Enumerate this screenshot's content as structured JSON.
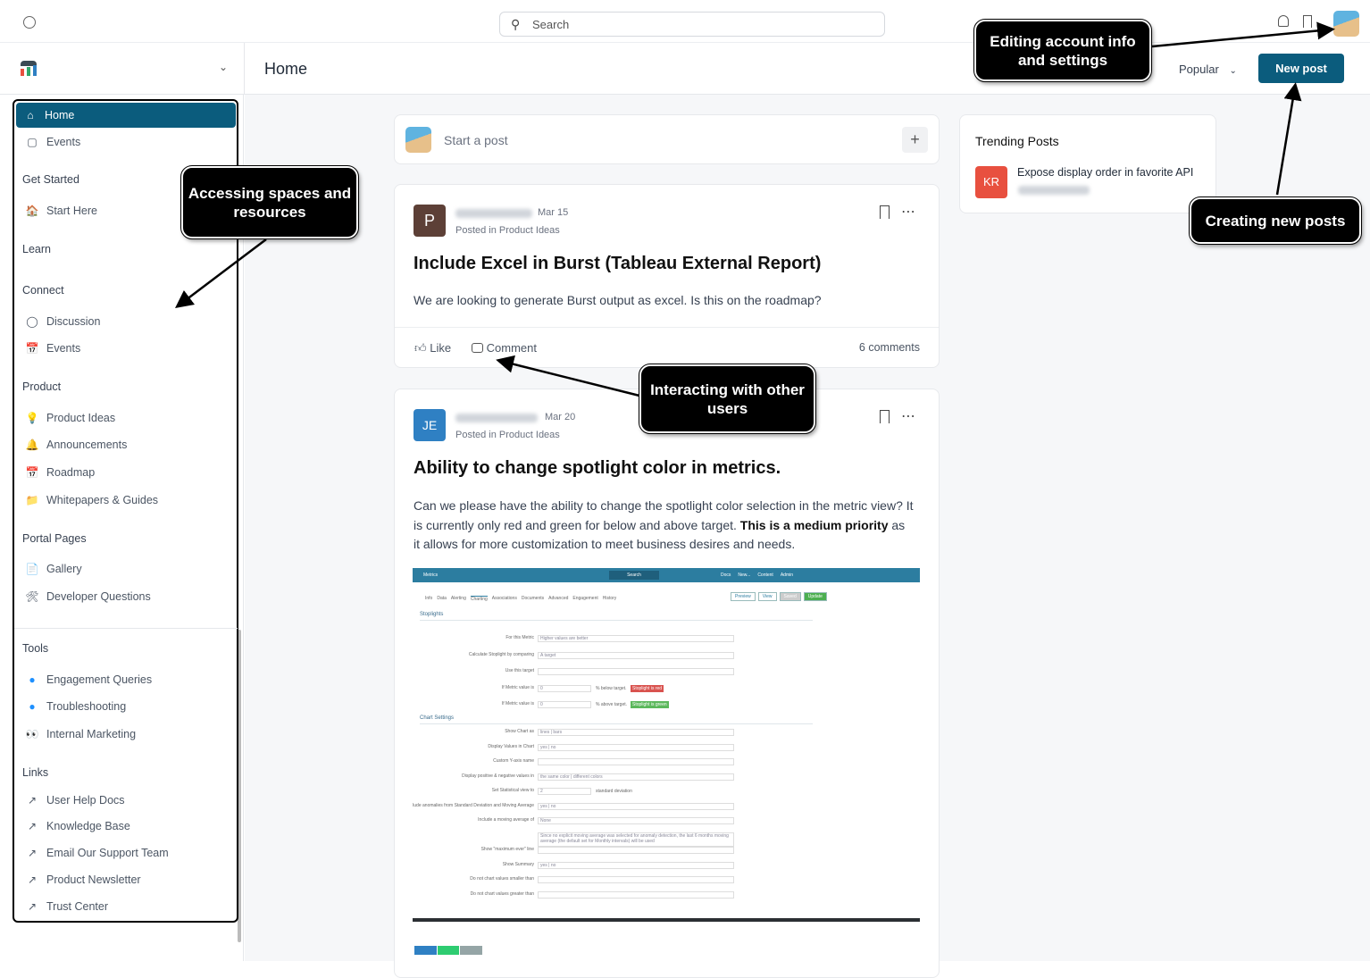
{
  "topbar": {
    "search_placeholder": "Search"
  },
  "header": {
    "title": "Home",
    "sort": "Popular",
    "new_post": "New post"
  },
  "sidebar": {
    "top": [
      {
        "label": "Home",
        "icon": "home-icon"
      },
      {
        "label": "Events",
        "icon": "calendar-icon"
      }
    ],
    "sections": [
      {
        "title": "Get Started",
        "items": [
          {
            "label": "Start Here",
            "icon": "house-emoji-icon"
          }
        ]
      },
      {
        "title": "Learn",
        "items": []
      },
      {
        "title": "Connect",
        "items": [
          {
            "label": "Discussion",
            "icon": "speech-bubble-icon"
          },
          {
            "label": "Events",
            "icon": "calendar-emoji-icon"
          }
        ]
      },
      {
        "title": "Product",
        "items": [
          {
            "label": "Product Ideas",
            "icon": "lightbulb-icon"
          },
          {
            "label": "Announcements",
            "icon": "bell-icon"
          },
          {
            "label": "Roadmap",
            "icon": "calendar-emoji-icon"
          },
          {
            "label": "Whitepapers & Guides",
            "icon": "folder-icon"
          }
        ]
      },
      {
        "title": "Portal Pages",
        "items": [
          {
            "label": "Gallery",
            "icon": "page-icon"
          },
          {
            "label": "Developer Questions",
            "icon": "tools-icon"
          }
        ]
      },
      {
        "title": "Tools",
        "items": [
          {
            "label": "Engagement Queries",
            "icon": "blue-dot-icon"
          },
          {
            "label": "Troubleshooting",
            "icon": "blue-dot-icon"
          },
          {
            "label": "Internal Marketing",
            "icon": "eyes-icon"
          }
        ]
      },
      {
        "title": "Links",
        "items": [
          {
            "label": "User Help Docs",
            "icon": "external-link-icon"
          },
          {
            "label": "Knowledge Base",
            "icon": "external-link-icon"
          },
          {
            "label": "Email Our Support Team",
            "icon": "external-link-icon"
          },
          {
            "label": "Product Newsletter",
            "icon": "external-link-icon"
          },
          {
            "label": "Trust Center",
            "icon": "external-link-icon"
          }
        ]
      }
    ]
  },
  "composer": {
    "placeholder": "Start a post"
  },
  "posts": [
    {
      "avatar": "P",
      "avatar_color": "#5d4037",
      "date": "Mar 15",
      "posted_in": "Posted in Product Ideas",
      "title": "Include Excel in Burst (Tableau External Report)",
      "body": "We are looking to generate Burst output as excel. Is this on the roadmap?",
      "like": "Like",
      "comment": "Comment",
      "comments_count": "6 comments"
    },
    {
      "avatar": "JE",
      "avatar_color": "#2f80c3",
      "date": "Mar 20",
      "posted_in": "Posted in Product Ideas",
      "title": "Ability to change spotlight color in metrics.",
      "body_1": "Can we please have the ability to change the spotlight color selection in the metric view? It is currently only red and green for below and above target.  ",
      "body_bold": "This is a medium priority",
      "body_2": " as it allows for more customization to meet business desires and needs."
    }
  ],
  "trending": {
    "title": "Trending Posts",
    "items": [
      {
        "avatar": "KR",
        "title": "Expose display order in favorite API"
      }
    ]
  },
  "screenshot": {
    "app": "Metrics",
    "search": "Search",
    "menu": [
      "Docs",
      "New...",
      "Content",
      "Admin"
    ],
    "tabs": [
      "Info",
      "Data",
      "Alerting",
      "Charting",
      "Associations",
      "Documents",
      "Advanced",
      "Engagement",
      "History"
    ],
    "buttons": [
      "Preview",
      "View",
      "Saved",
      "Update"
    ],
    "section1": "Stoplights",
    "section2": "Chart Settings",
    "rows": [
      {
        "label": "For this Metric",
        "value": "Higher values are better"
      },
      {
        "label": "Calculate Stoplight by comparing",
        "value": "A target"
      },
      {
        "label": "Use this target",
        "value": ""
      },
      {
        "label": "If Metric value is",
        "value": "0",
        "suffix": "% below target.",
        "badge": "Stoplight is red"
      },
      {
        "label": "If Metric value is",
        "value": "0",
        "suffix": "% above target.",
        "badge": "Stoplight is green"
      }
    ],
    "rows2": [
      {
        "label": "Show Chart as",
        "value": "lines | bars"
      },
      {
        "label": "Display Values in Chart",
        "value": "yes | no"
      },
      {
        "label": "Custom Y-axis name",
        "value": ""
      },
      {
        "label": "Display positive & negative values in",
        "value": "the same color | different colors"
      },
      {
        "label": "Set Statistical view to",
        "value": "2",
        "suffix": "standard deviation"
      },
      {
        "label": "Exclude anomalies from Standard Deviation and Moving Average",
        "value": "yes | no"
      },
      {
        "label": "Include a moving average of",
        "value": "None"
      },
      {
        "label": "",
        "value": "Since no explicit moving average was selected for anomaly detection, the last 6 months moving average (the default set for Monthly intervals) will be used"
      },
      {
        "label": "Show \"maximum ever\" line",
        "value": ""
      },
      {
        "label": "Show Summary",
        "value": "yes | no"
      },
      {
        "label": "Do not chart values smaller than",
        "value": ""
      },
      {
        "label": "Do not chart values greater than",
        "value": ""
      }
    ]
  },
  "callouts": {
    "spaces": "Accessing spaces and resources",
    "account": "Editing account info and settings",
    "interact": "Interacting with other users",
    "create": "Creating new posts"
  },
  "colors": {
    "primary": "#0b5c7d",
    "kr": "#e8503f"
  }
}
